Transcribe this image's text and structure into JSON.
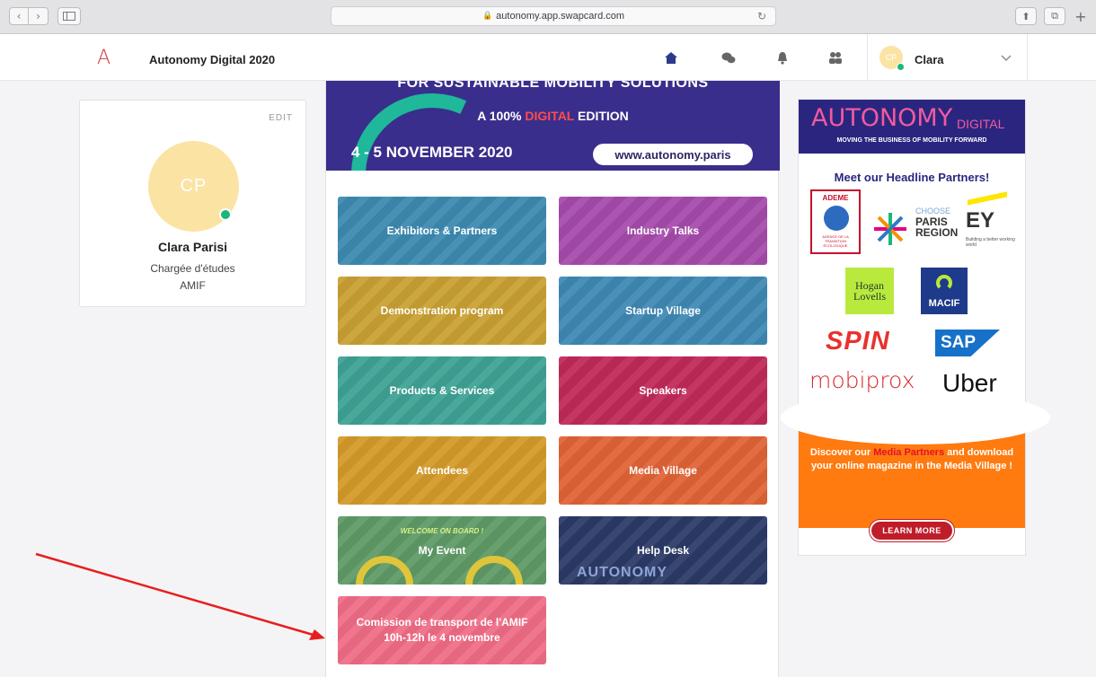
{
  "browser": {
    "url": "autonomy.app.swapcard.com",
    "back_glyph": "‹",
    "forward_glyph": "›",
    "lock_glyph": "🔒",
    "reload_glyph": "↻",
    "share_glyph": "⬆",
    "tabs_glyph": "⧉",
    "newtab_glyph": "+"
  },
  "header": {
    "logo": "A",
    "event_title": "Autonomy Digital 2020",
    "icons": [
      "home-icon",
      "chat-icon",
      "bell-icon",
      "people-icon"
    ],
    "user": {
      "initials": "CP",
      "name": "Clara",
      "chevron": "⌄"
    }
  },
  "profile": {
    "edit_label": "EDIT",
    "initials": "CP",
    "name": "Clara Parisi",
    "role": "Chargée d'études",
    "organization": "AMIF"
  },
  "banner": {
    "top_line": "FOR SUSTAINABLE MOBILITY SOLUTIONS",
    "edition_prefix": "A 100% ",
    "edition_highlight": "DIGITAL",
    "edition_suffix": " EDITION",
    "dates": "4 - 5 NOVEMBER 2020",
    "website": "www.autonomy.paris"
  },
  "tiles": [
    {
      "label": "Exhibitors & Partners",
      "color": "#3c8ab0"
    },
    {
      "label": "Industry Talks",
      "color": "#a54bab"
    },
    {
      "label": "Demonstration program",
      "color": "#c9a032"
    },
    {
      "label": "Startup Village",
      "color": "#3f89b4"
    },
    {
      "label": "Products & Services",
      "color": "#3ea294"
    },
    {
      "label": "Speakers",
      "color": "#c02a59"
    },
    {
      "label": "Attendees",
      "color": "#d39a2a"
    },
    {
      "label": "Media Village",
      "color": "#e06336"
    },
    {
      "label": "My Event",
      "color": "#5f9a66",
      "banner_text": "WELCOME ON BOARD !"
    },
    {
      "label": "Help Desk",
      "color": "#2b3a66",
      "watermark": "AUTONOMY"
    },
    {
      "label": "Comission de transport de l'AMIF 10h-12h le 4 novembre",
      "color": "#ef6d86"
    }
  ],
  "ad": {
    "logo": "AUTONOMY",
    "logo_suffix": "DIGITAL",
    "tagline": "MOVING THE BUSINESS OF MOBILITY FORWARD",
    "headline": "Meet our Headline Partners!",
    "partners": {
      "ademe": "ADEME",
      "ademe_sub": "AGENCE DE LA TRANSITION ÉCOLOGIQUE",
      "choose": "CHOOSE",
      "paris_region": "PARIS REGION",
      "ey": "EY",
      "ey_sub": "Building a better working world",
      "hogan": "Hogan Lovells",
      "macif": "MACIF",
      "spin": "SPIN",
      "sap": "SAP",
      "mobiprox": "mobiprox",
      "uber": "Uber"
    },
    "promo_prefix": "Discover our ",
    "promo_highlight": "Media Partners",
    "promo_suffix": " and download your online magazine in the Media Village !",
    "button": "LEARN MORE"
  },
  "colors": {
    "brand_purple": "#3a2e8c",
    "brand_red": "#d33a3a",
    "online_green": "#1ab67a",
    "annotation_arrow": "#e81e1e"
  }
}
